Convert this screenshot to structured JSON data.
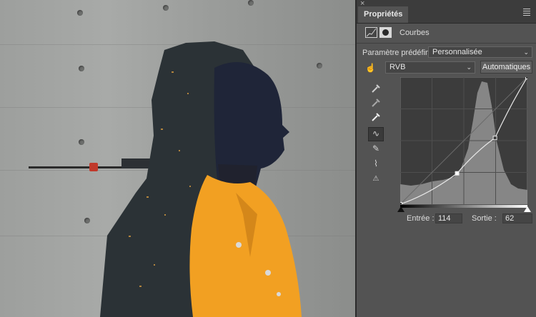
{
  "panel": {
    "tab_label": "Propriétés",
    "adjustment_name": "Courbes",
    "preset_label": "Paramètre prédéfini :",
    "preset_value": "Personnalisée",
    "channel_value": "RVB",
    "auto_button": "Automatiques",
    "input_label": "Entrée :",
    "input_value": "114",
    "output_label": "Sortie :",
    "output_value": "62"
  },
  "icons": {
    "close": "×",
    "chevron": "⌄",
    "curve_tool": "∿",
    "pencil_tool": "✎",
    "smooth_tool": "⌇",
    "warning": "⚠"
  },
  "colors": {
    "panel_bg": "#535353",
    "jacket": "#f2a022",
    "sky_wall": "#9fa19f",
    "histogram": "#8e8e8e"
  },
  "curve": {
    "points_input": [
      0,
      114,
      190,
      255
    ],
    "points_output": [
      0,
      62,
      133,
      255
    ],
    "selected_point": {
      "input": 114,
      "output": 62
    }
  }
}
